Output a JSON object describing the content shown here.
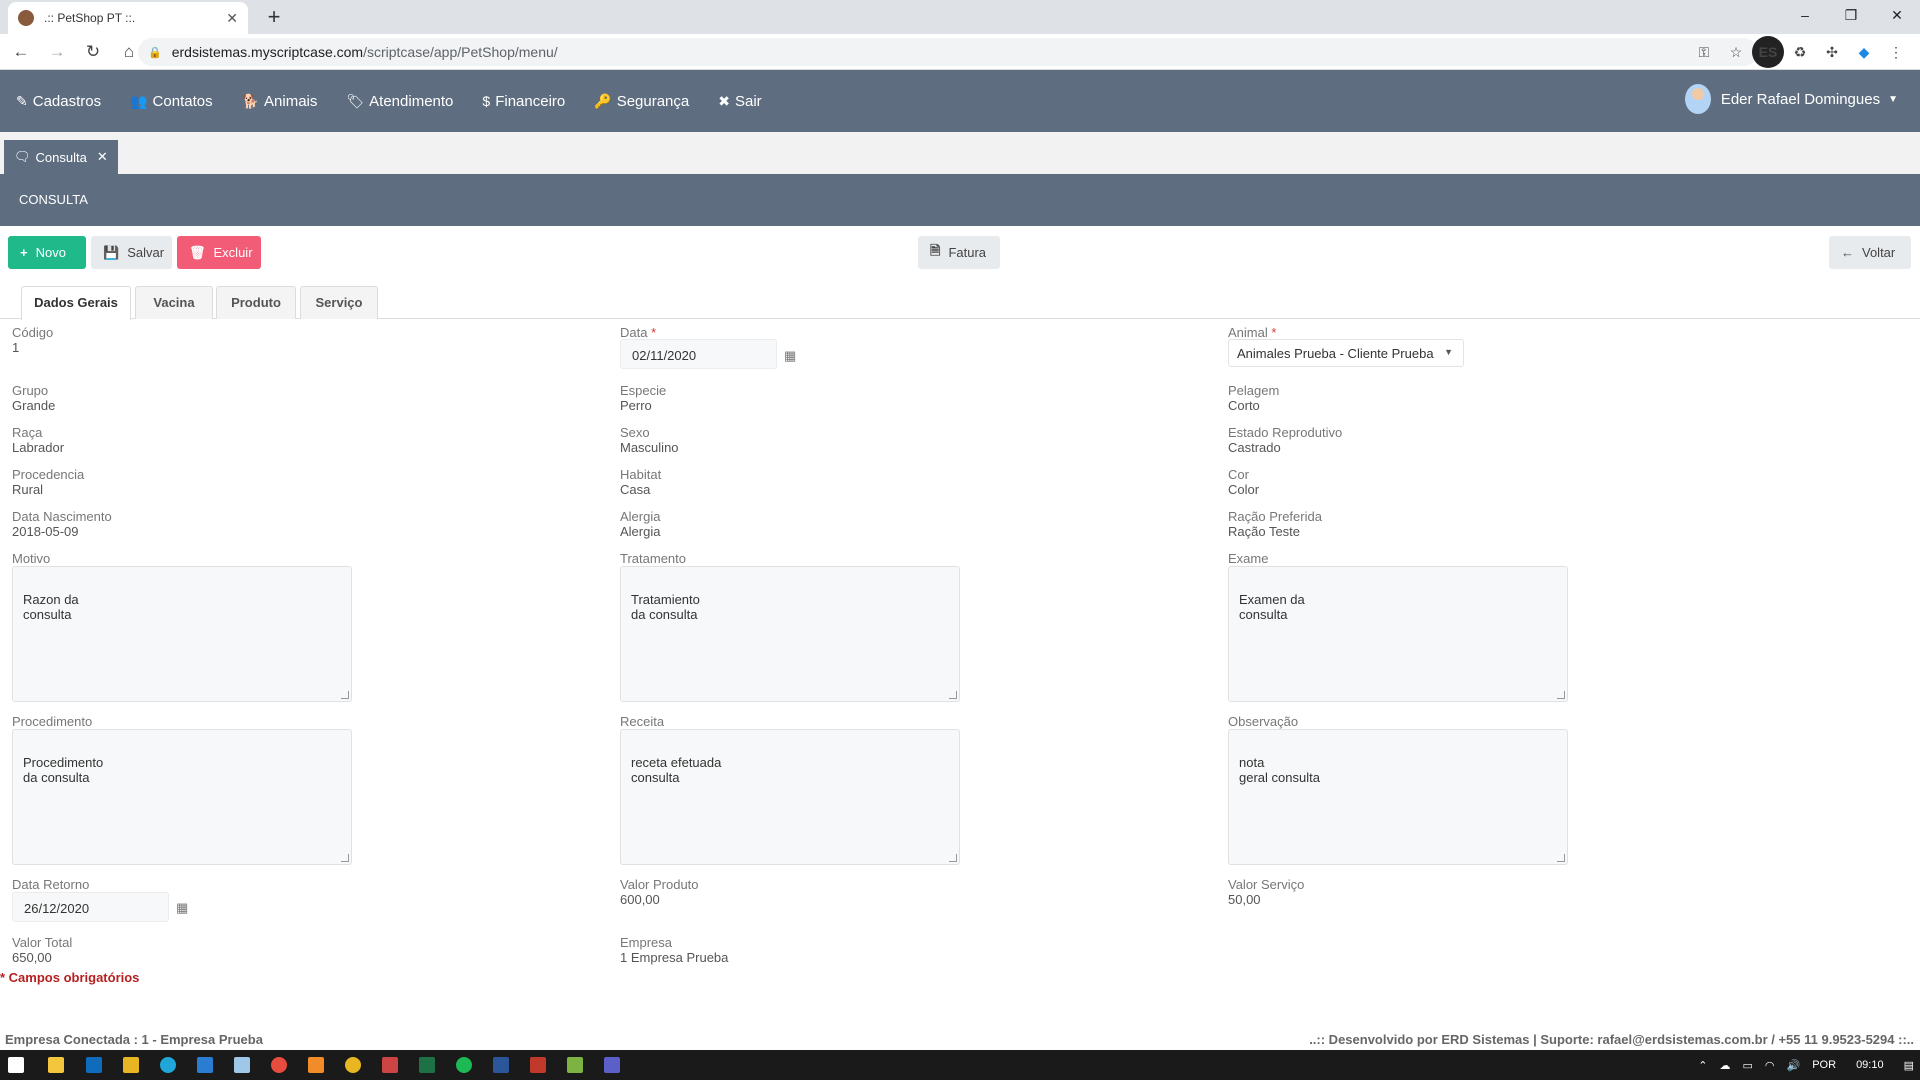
{
  "browser": {
    "tab_title": ".:: PetShop PT ::.",
    "tab_close": "✕",
    "new_tab": "+",
    "url_host": "erdsistemas.myscriptcase.com",
    "url_path": "/scriptcase/app/PetShop/menu/",
    "window_controls": [
      "–",
      "❐",
      "✕"
    ],
    "extension_badge": "ES"
  },
  "nav": {
    "menu": [
      {
        "label": "Cadastros",
        "icon": "✎"
      },
      {
        "label": "Contatos",
        "icon": "👥"
      },
      {
        "label": "Animais",
        "icon": "🐕"
      },
      {
        "label": "Atendimento",
        "icon": "🏷"
      },
      {
        "label": "Financeiro",
        "icon": "$"
      },
      {
        "label": "Segurança",
        "icon": "🔑"
      },
      {
        "label": "Sair",
        "icon": "✖"
      }
    ],
    "user_name": "Eder Rafael Domingues"
  },
  "subtab": {
    "label": "Consulta",
    "close": "✕"
  },
  "page_title": "CONSULTA",
  "toolbar": {
    "novo": "Novo",
    "salvar": "Salvar",
    "excluir": "Excluir",
    "fatura": "Fatura",
    "voltar": "Voltar"
  },
  "form_tabs": [
    "Dados Gerais",
    "Vacina",
    "Produto",
    "Serviço"
  ],
  "fields": {
    "codigo": {
      "label": "Código",
      "value": "1"
    },
    "data": {
      "label": "Data",
      "value": "02/11/2020"
    },
    "animal": {
      "label": "Animal",
      "value": "Animales Prueba - Cliente Prueba"
    },
    "grupo": {
      "label": "Grupo",
      "value": "Grande"
    },
    "especie": {
      "label": "Especie",
      "value": "Perro"
    },
    "pelagem": {
      "label": "Pelagem",
      "value": "Corto"
    },
    "raca": {
      "label": "Raça",
      "value": "Labrador"
    },
    "sexo": {
      "label": "Sexo",
      "value": "Masculino"
    },
    "estado_reprodutivo": {
      "label": "Estado Reprodutivo",
      "value": "Castrado"
    },
    "procedencia": {
      "label": "Procedencia",
      "value": "Rural"
    },
    "habitat": {
      "label": "Habitat",
      "value": "Casa"
    },
    "cor": {
      "label": "Cor",
      "value": "Color"
    },
    "data_nascimento": {
      "label": "Data Nascimento",
      "value": "2018-05-09"
    },
    "alergia": {
      "label": "Alergia",
      "value": "Alergia"
    },
    "racao_preferida": {
      "label": "Ração Preferida",
      "value": "Ração Teste"
    },
    "motivo": {
      "label": "Motivo",
      "value": "Razon da\nconsulta"
    },
    "tratamento": {
      "label": "Tratamento",
      "value": "Tratamiento\nda consulta"
    },
    "exame": {
      "label": "Exame",
      "value": "Examen da\nconsulta"
    },
    "procedimento": {
      "label": "Procedimento",
      "value": "Procedimento\nda consulta"
    },
    "receita": {
      "label": "Receita",
      "value": "receta efetuada\nconsulta"
    },
    "observacao": {
      "label": "Observação",
      "value": "nota\ngeral consulta"
    },
    "data_retorno": {
      "label": "Data Retorno",
      "value": "26/12/2020"
    },
    "valor_produto": {
      "label": "Valor Produto",
      "value": "600,00"
    },
    "valor_servico": {
      "label": "Valor Serviço",
      "value": "50,00"
    },
    "valor_total": {
      "label": "Valor Total",
      "value": "650,00"
    },
    "empresa": {
      "label": "Empresa",
      "value": "1 Empresa Prueba"
    }
  },
  "required_note": "* Campos obrigatórios",
  "status": {
    "left": "Empresa Conectada : 1 - Empresa Prueba",
    "right": "..:: Desenvolvido por ERD Sistemas | Suporte: rafael@erdsistemas.com.br / +55 11 9.9523-5294 ::.."
  },
  "taskbar": {
    "lang": "POR",
    "time": "09:10"
  }
}
